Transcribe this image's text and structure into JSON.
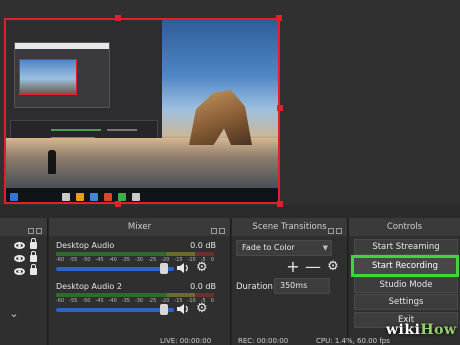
{
  "colors": {
    "selection": "#e0202a",
    "highlight": "#3ed63a",
    "fader": "#2f63c8",
    "panel": "#2f2f2f"
  },
  "mixer": {
    "title": "Mixer",
    "channels": [
      {
        "name": "Desktop Audio",
        "db": "0.0 dB",
        "level": 0.93
      },
      {
        "name": "Desktop Audio 2",
        "db": "0.0 dB",
        "level": 0.93
      }
    ],
    "scale": [
      "-60",
      "-55",
      "-50",
      "-45",
      "-40",
      "-35",
      "-30",
      "-25",
      "-20",
      "-15",
      "-10",
      "-5",
      "0"
    ]
  },
  "transitions": {
    "title": "Scene Transitions",
    "selected": "Fade to Color",
    "duration_label": "Duration",
    "duration_value": "350ms"
  },
  "controls": {
    "title": "Controls",
    "start_streaming": "Start Streaming",
    "start_recording": "Start Recording",
    "studio_mode": "Studio Mode",
    "settings": "Settings",
    "exit": "Exit"
  },
  "status": {
    "live": "LIVE: 00:00:00",
    "rec": "REC: 00:00:00",
    "cpu": "CPU: 1.4%, 60.00 fps"
  },
  "watermark": {
    "wiki": "wiki",
    "how": "How"
  }
}
